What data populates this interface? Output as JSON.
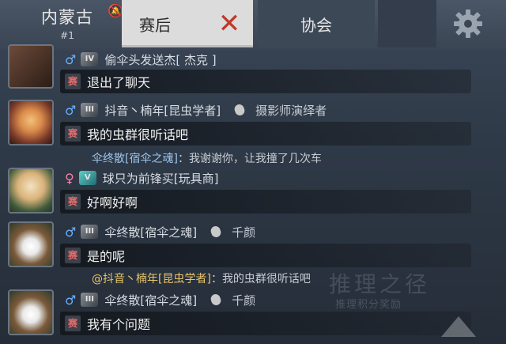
{
  "header": {
    "location_name": "内蒙古",
    "location_rank": "#1",
    "tabs": [
      {
        "label": "赛后",
        "active": true
      },
      {
        "label": "协会",
        "active": false
      }
    ]
  },
  "background_watermark": {
    "title": "推理之径",
    "subtitle": "推理积分奖励"
  },
  "messages": [
    {
      "name": "偷伞头发送杰[ 杰克 ]",
      "gender": "male",
      "rank": "IV",
      "channel": "赛",
      "text": "退出了聊天"
    },
    {
      "name": "抖音丶楠年[昆虫学者]",
      "gender": "male",
      "rank": "III",
      "title": "摄影师演绎者",
      "channel": "赛",
      "text": "我的虫群很听话吧",
      "quote": {
        "author": "伞终散[宿伞之魂]",
        "sep": "：",
        "text": "我谢谢你，让我撞了几次车"
      }
    },
    {
      "name": "球只为前锋买[玩具商]",
      "gender": "female",
      "rank": "V",
      "channel": "赛",
      "text": "好啊好啊"
    },
    {
      "name": "伞终散[宿伞之魂]",
      "gender": "male",
      "rank": "III",
      "title": "千颜",
      "channel": "赛",
      "text": "是的呢",
      "quote": {
        "author": "@抖音丶楠年[昆虫学者]",
        "sep": "：",
        "text": "我的虫群很听话吧"
      }
    },
    {
      "name": "伞终散[宿伞之魂]",
      "gender": "male",
      "rank": "III",
      "title": "千颜",
      "channel": "赛",
      "text": "我有个问题"
    }
  ],
  "colors": {
    "tab_active_bg": "#dcdcdc",
    "close_red": "#c0392b",
    "male_blue": "#6ab0ff",
    "female_pink": "#ff7ea8",
    "quote_blue": "#9ec6ee",
    "at_gold": "#e8c46a"
  }
}
